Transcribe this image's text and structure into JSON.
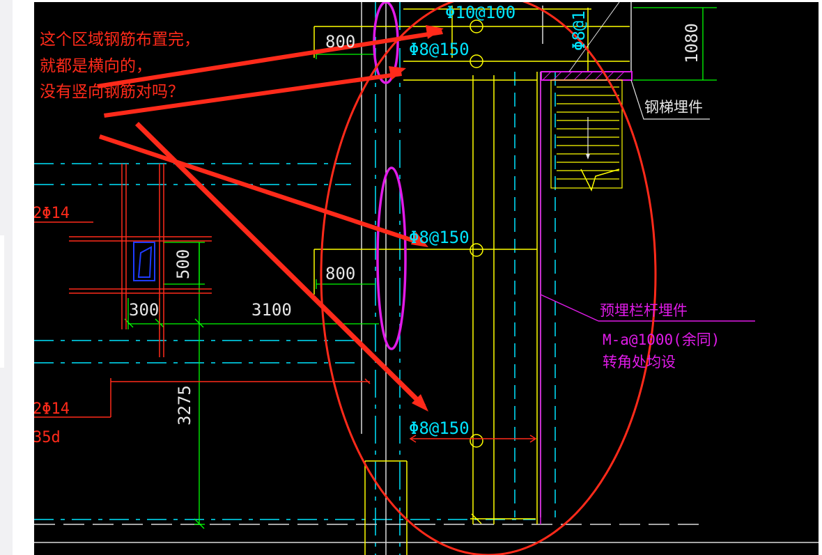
{
  "annotation": {
    "line1": "这个区域钢筋布置完，",
    "line2": "就都是横向的，",
    "line3": "没有竖向钢筋对吗？"
  },
  "labels": {
    "rebar_top": "Φ10@100",
    "rebar_1": "Φ8@150",
    "rebar_2": "Φ8@150",
    "rebar_3": "Φ8@150",
    "rebar_vertical": "Φ8@1",
    "dim_800_top": "800",
    "dim_800_mid": "800",
    "dim_1080": "1080",
    "dim_500": "500",
    "dim_300": "300",
    "dim_3100": "3100",
    "dim_3275": "3275",
    "rebar_left_1": "2Φ14",
    "rebar_left_2": "2Φ14",
    "rebar_left_3": "35d",
    "stair_embed": "钢梯埋件",
    "rail_title": "预埋栏杆埋件",
    "rail_spec": "M-a@1000(余同)",
    "rail_note": "转角处均设"
  },
  "colors": {
    "annotation": "#ff2a1a",
    "cyan": "#00e5ff",
    "yellow": "#ffff00",
    "green": "#00ff00",
    "magenta": "#e01be8",
    "white": "#e6e6e6",
    "background": "#000000"
  }
}
